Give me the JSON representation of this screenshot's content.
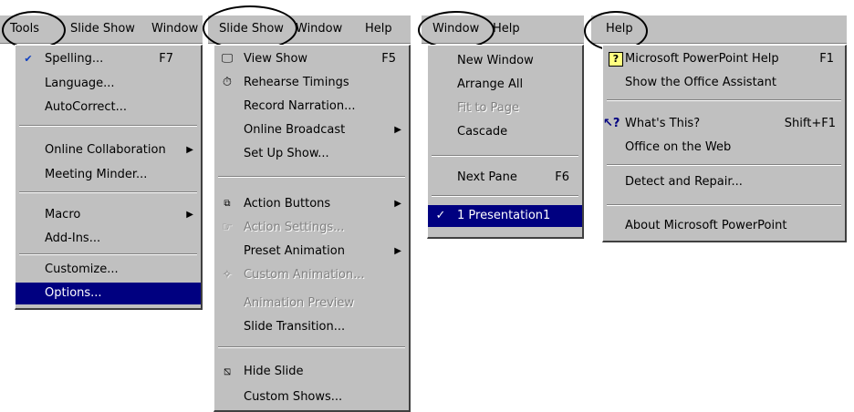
{
  "tools": {
    "menubar": [
      "Tools",
      "Slide Show",
      "Window"
    ],
    "items": [
      {
        "label": "Spelling...",
        "accel": "F7",
        "icon": "spelling-icon"
      },
      {
        "label": "Language..."
      },
      {
        "label": "AutoCorrect..."
      },
      {
        "label": "Online Collaboration",
        "submenu": true
      },
      {
        "label": "Meeting Minder..."
      },
      {
        "label": "Macro",
        "submenu": true
      },
      {
        "label": "Add-Ins..."
      },
      {
        "label": "Customize..."
      },
      {
        "label": "Options...",
        "highlighted": true
      }
    ]
  },
  "slideshow": {
    "menubar": [
      "Slide Show",
      "Window",
      "Help"
    ],
    "items": [
      {
        "label": "View Show",
        "accel": "F5",
        "icon": "view-show-icon"
      },
      {
        "label": "Rehearse Timings",
        "icon": "rehearse-timings-icon"
      },
      {
        "label": "Record Narration..."
      },
      {
        "label": "Online Broadcast",
        "submenu": true
      },
      {
        "label": "Set Up Show..."
      },
      {
        "label": "Action Buttons",
        "submenu": true,
        "icon": "action-buttons-icon"
      },
      {
        "label": "Action Settings...",
        "disabled": true,
        "icon": "action-settings-icon"
      },
      {
        "label": "Preset Animation",
        "submenu": true
      },
      {
        "label": "Custom Animation...",
        "disabled": true,
        "icon": "custom-animation-icon"
      },
      {
        "label": "Animation Preview",
        "disabled": true
      },
      {
        "label": "Slide Transition..."
      },
      {
        "label": "Hide Slide",
        "icon": "hide-slide-icon"
      },
      {
        "label": "Custom Shows..."
      }
    ]
  },
  "window": {
    "menubar": [
      "Window",
      "Help"
    ],
    "items": [
      {
        "label": "New Window"
      },
      {
        "label": "Arrange All"
      },
      {
        "label": "Fit to Page",
        "disabled": true
      },
      {
        "label": "Cascade"
      },
      {
        "label": "Next Pane",
        "accel": "F6"
      },
      {
        "label": "1 Presentation1",
        "highlighted": true,
        "checked": true
      }
    ]
  },
  "help": {
    "menubar": [
      "Help"
    ],
    "items": [
      {
        "label": "Microsoft PowerPoint Help",
        "accel": "F1",
        "icon": "help-icon"
      },
      {
        "label": "Show the Office Assistant"
      },
      {
        "label": "What's This?",
        "accel": "Shift+F1",
        "icon": "whats-this-icon"
      },
      {
        "label": "Office on the Web"
      },
      {
        "label": "Detect and Repair..."
      },
      {
        "label": "About Microsoft PowerPoint"
      }
    ]
  },
  "colors": {
    "menu_bg": "#c0c0c0",
    "highlight": "#000080",
    "disabled": "#808080"
  }
}
